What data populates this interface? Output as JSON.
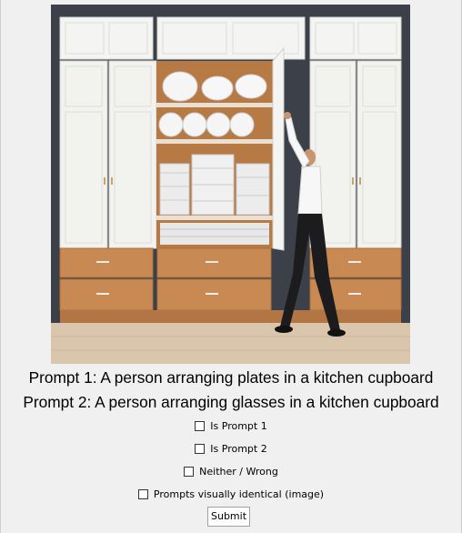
{
  "prompts": {
    "prompt1": "Prompt 1: A person arranging plates in a kitchen cupboard",
    "prompt2": "Prompt 2: A person arranging glasses in a kitchen cupboard"
  },
  "options": [
    {
      "label": "Is Prompt 1",
      "checked": false
    },
    {
      "label": "Is Prompt 2",
      "checked": false
    },
    {
      "label": "Neither / Wrong",
      "checked": false
    },
    {
      "label": "Prompts visually identical (image)",
      "checked": false
    }
  ],
  "submit_label": "Submit"
}
